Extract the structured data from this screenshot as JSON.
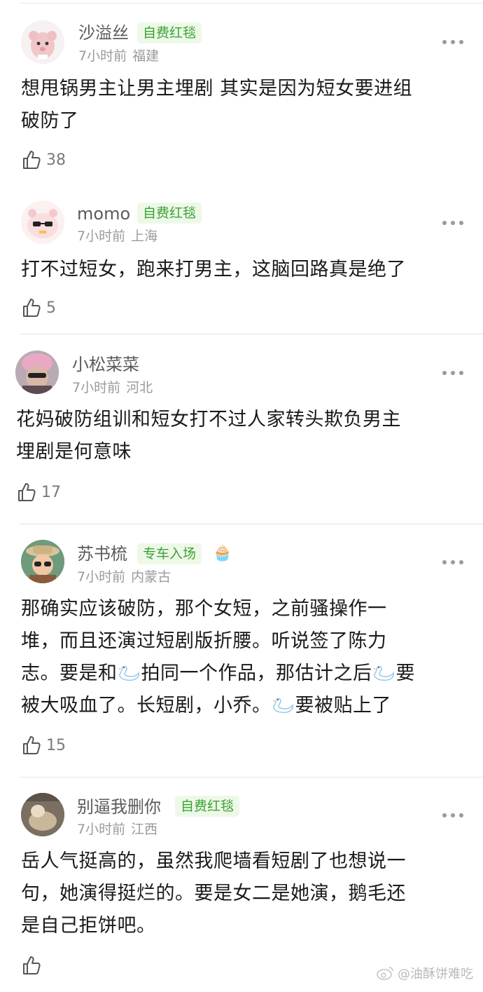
{
  "comments": [
    {
      "username": "沙溢丝",
      "badge": "自费红毯",
      "time": "7小时前",
      "location": "福建",
      "text_lines": [
        "想甩锅男主让男主埋剧 其实是因为短女要进组",
        "破防了"
      ],
      "likes": "38",
      "avatar_icon": "pink-bear-avatar-icon"
    },
    {
      "username": "momo",
      "badge": "自费红毯",
      "time": "7小时前",
      "location": "上海",
      "text_lines": [
        "打不过短女，跑来打男主，这脑回路真是绝了"
      ],
      "likes": "5",
      "avatar_icon": "sunglasses-creature-avatar-icon"
    },
    {
      "username": "小松菜菜",
      "badge": "",
      "time": "7小时前",
      "location": "河北",
      "text_lines": [
        "花妈破防组训和短女打不过人家转头欺负男主",
        "埋剧是何意味"
      ],
      "likes": "17",
      "avatar_icon": "pink-hat-person-avatar-icon"
    },
    {
      "username": "苏书梳",
      "badge": "专车入场",
      "badge_emoji": "🧁",
      "time": "7小时前",
      "location": "内蒙古",
      "text_lines": [
        [
          "那确实应该破防，那个女短，之前骚操作一"
        ],
        [
          "堆，而且还演过短剧版折腰。听说签了陈力"
        ],
        [
          "志。要是和",
          "{swan}",
          "拍同一个作品，那估计之后",
          "{swan}",
          "要"
        ],
        [
          "被大吸血了。长短剧，小乔。",
          "{swan}",
          "要被贴上了"
        ]
      ],
      "likes": "15",
      "avatar_icon": "cartoon-explorer-avatar-icon"
    },
    {
      "username": "别逼我删你",
      "badge": "自费红毯",
      "time": "7小时前",
      "location": "江西",
      "text_lines": [
        "岳人气挺高的，虽然我爬墙看短剧了也想说一",
        "句，她演得挺烂的。要是女二是她演，鹅毛还",
        "是自己拒饼吧。"
      ],
      "likes": "",
      "avatar_icon": "photo-avatar-icon"
    }
  ],
  "watermark": "@油酥饼难吃",
  "colors": {
    "badge_green": "#3aa336",
    "badge_bg": "#eef8e7",
    "meta_gray": "#9a9a9a"
  }
}
